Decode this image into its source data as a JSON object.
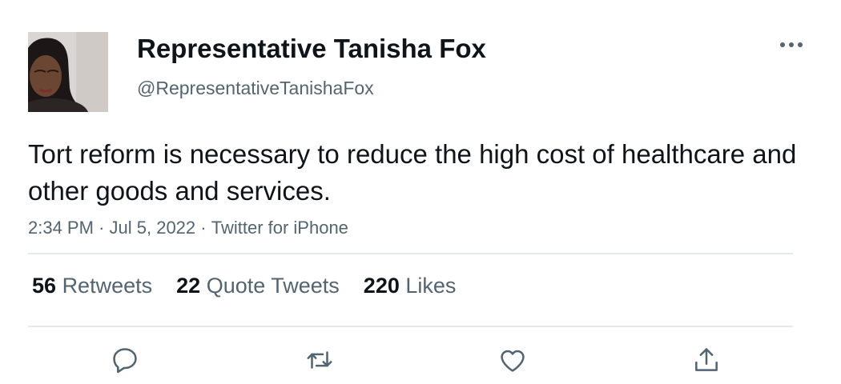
{
  "author": {
    "display_name": "Representative Tanisha Fox",
    "handle": "@RepresentativeTanishaFox"
  },
  "tweet": {
    "text": "Tort reform is necessary to reduce the high cost of healthcare and other goods and services.",
    "time": "2:34 PM",
    "date": "Jul 5, 2022",
    "source": "Twitter for iPhone",
    "separator": "·"
  },
  "stats": {
    "retweets": {
      "count": "56",
      "label": "Retweets"
    },
    "quote_tweets": {
      "count": "22",
      "label": "Quote Tweets"
    },
    "likes": {
      "count": "220",
      "label": "Likes"
    }
  },
  "icons": {
    "more": "more-horizontal-icon",
    "reply": "reply-icon",
    "retweet": "retweet-icon",
    "like": "heart-icon",
    "share": "share-icon"
  },
  "colors": {
    "text_primary": "#0f1419",
    "text_secondary": "#536471",
    "divider": "#e6e9eb"
  }
}
